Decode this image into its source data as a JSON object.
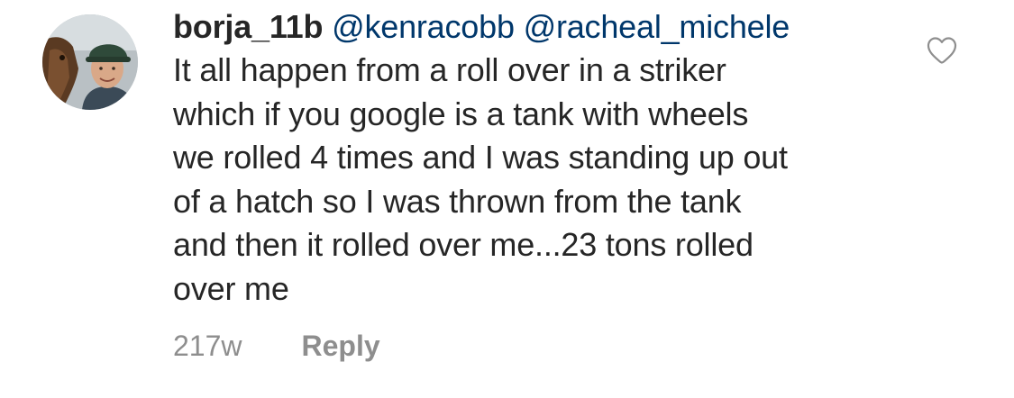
{
  "comment": {
    "username": "borja_11b",
    "mentions": [
      "@kenracobb",
      "@racheal_michele"
    ],
    "text_lines": [
      "It all happen from a roll over in a striker",
      "which if you google is a tank  with wheels",
      "we rolled 4 times and I was standing up out",
      "of a hatch so I was thrown from the tank",
      "and then it rolled over me...23 tons rolled",
      "over me"
    ],
    "timestamp": "217w",
    "reply_label": "Reply",
    "like_icon": "heart-outline-icon"
  },
  "colors": {
    "username": "#262626",
    "mention": "#00376b",
    "text": "#262626",
    "meta": "#8e8e8e"
  }
}
